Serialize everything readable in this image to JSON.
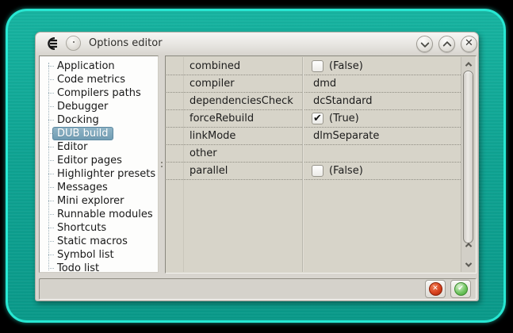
{
  "colors": {
    "desktop_fill": "#0fa493",
    "desktop_edge": "#27e7d2",
    "selection_bg": "#7fa9bf",
    "selection_border": "#5d89a1",
    "cancel_red": "#cf3612",
    "accept_green": "#52b143"
  },
  "titlebar": {
    "title": "Options editor",
    "app_icon": "coedit-logo-icon",
    "menu_button_icon": "window-menu-icon",
    "controls": [
      {
        "id": "minimize",
        "icon": "chevron-down-icon"
      },
      {
        "id": "maximize",
        "icon": "chevron-up-icon"
      },
      {
        "id": "close",
        "icon": "close-icon",
        "glyph": "✕"
      }
    ]
  },
  "sidebar": {
    "items": [
      {
        "label": "Application",
        "selected": false
      },
      {
        "label": "Code metrics",
        "selected": false
      },
      {
        "label": "Compilers paths",
        "selected": false
      },
      {
        "label": "Debugger",
        "selected": false
      },
      {
        "label": "Docking",
        "selected": false
      },
      {
        "label": "DUB build",
        "selected": true
      },
      {
        "label": "Editor",
        "selected": false
      },
      {
        "label": "Editor pages",
        "selected": false
      },
      {
        "label": "Highlighter presets",
        "selected": false
      },
      {
        "label": "Messages",
        "selected": false
      },
      {
        "label": "Mini explorer",
        "selected": false
      },
      {
        "label": "Runnable modules",
        "selected": false
      },
      {
        "label": "Shortcuts",
        "selected": false
      },
      {
        "label": "Static macros",
        "selected": false
      },
      {
        "label": "Symbol list",
        "selected": false
      },
      {
        "label": "Todo list",
        "selected": false
      }
    ]
  },
  "property_grid": {
    "rows": [
      {
        "name": "combined",
        "control": "checkbox",
        "checked": false,
        "value": "(False)"
      },
      {
        "name": "compiler",
        "control": "text",
        "checked": false,
        "value": "dmd"
      },
      {
        "name": "dependenciesCheck",
        "control": "text",
        "checked": false,
        "value": "dcStandard"
      },
      {
        "name": "forceRebuild",
        "control": "checkbox",
        "checked": true,
        "value": "(True)"
      },
      {
        "name": "linkMode",
        "control": "text",
        "checked": false,
        "value": "dlmSeparate"
      },
      {
        "name": "other",
        "control": "text",
        "checked": false,
        "value": ""
      },
      {
        "name": "parallel",
        "control": "checkbox",
        "checked": false,
        "value": "(False)"
      }
    ],
    "scrollbar": {
      "up_icon": "chevron-up-icon",
      "down_icon": "chevron-down-icon"
    }
  },
  "footer": {
    "buttons": [
      {
        "id": "cancel",
        "icon": "cancel-icon",
        "glyph": "✕"
      },
      {
        "id": "accept",
        "icon": "accept-icon",
        "glyph": "✔"
      }
    ]
  }
}
